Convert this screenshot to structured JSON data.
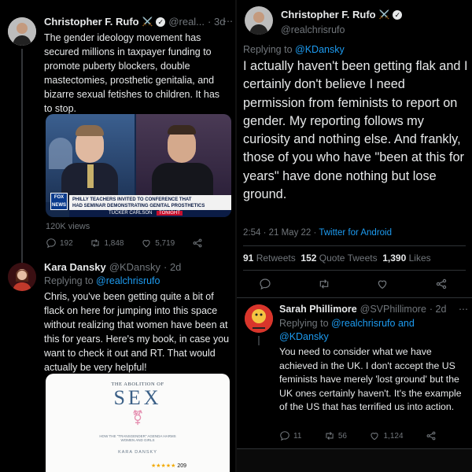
{
  "left": {
    "tweet1": {
      "name": "Christopher F. Rufo",
      "badge": "⚔️",
      "handle": "@real...",
      "time": "· 3d",
      "text": "The gender ideology movement has secured millions in taxpayer funding to promote puberty blockers, double mastectomies, prosthetic genitalia, and bizarre sexual fetishes to children. It has to stop.",
      "video": {
        "chyron_line1": "PHILLY TEACHERS INVITED TO CONFERENCE THAT",
        "chyron_line2": "HAD SEMINAR DEMONSTRATING GENITAL PROSTHETICS",
        "show": "TUCKER CARLSON",
        "tonight": "TONIGHT",
        "network": "FOX NEWS"
      },
      "views": "120K views",
      "replies": "192",
      "retweets": "1,848",
      "likes": "5,719"
    },
    "tweet2": {
      "name": "Kara Dansky",
      "handle": "@KDansky",
      "time": "· 2d",
      "replying_prefix": "Replying to ",
      "replying_to": "@realchrisrufo",
      "text": "Chris, you've been getting quite a bit of flack on here for jumping into this space without realizing that women have been at this for years. Here's my book, in case you want to check it out and RT. That would actually be very helpful!",
      "book": {
        "title_small": "THE ABOLITION OF",
        "title_big": "SEX",
        "subtitle": "HOW THE \"TRANSGENDER\" AGENDA HARMS WOMEN AND GIRLS",
        "author": "KARA DANSKY",
        "stars": "★★★★★",
        "rating_count": "209"
      }
    }
  },
  "right": {
    "main": {
      "name": "Christopher F. Rufo",
      "badge": "⚔️",
      "handle": "@realchrisrufo",
      "replying_prefix": "Replying to ",
      "replying_to": "@KDansky",
      "text": "I actually haven't been getting flak and I certainly don't believe I need permission from feminists to report on gender. My reporting follows my curiosity and nothing else. And frankly, those of you who have \"been at this for years\" have done nothing but lose ground.",
      "timestamp": "2:54 · 21 May 22 · ",
      "source": "Twitter for Android",
      "retweets_count": "91",
      "retweets_label": " Retweets",
      "quotes_count": "152",
      "quotes_label": " Quote Tweets",
      "likes_count": "1,390",
      "likes_label": " Likes"
    },
    "reply": {
      "name": "Sarah Phillimore",
      "handle": "@SVPhillimore",
      "time": "· 2d",
      "replying_prefix": "Replying to ",
      "replying_to1": "@realchrisrufo",
      "replying_and": " and",
      "replying_to2": "@KDansky",
      "text": "You need to consider what we have achieved in the UK. I don't accept the US feminists have merely 'lost ground' but the UK ones certainly haven't. It's the example of the US that has terrified us into action.",
      "replies": "11",
      "retweets": "56",
      "likes": "1,124"
    }
  },
  "colors": {
    "link": "#1d9bf0",
    "muted": "#71767b",
    "bg": "#000000"
  },
  "icons": [
    "reply-icon",
    "retweet-icon",
    "like-icon",
    "share-icon",
    "verified-icon",
    "more-icon"
  ]
}
